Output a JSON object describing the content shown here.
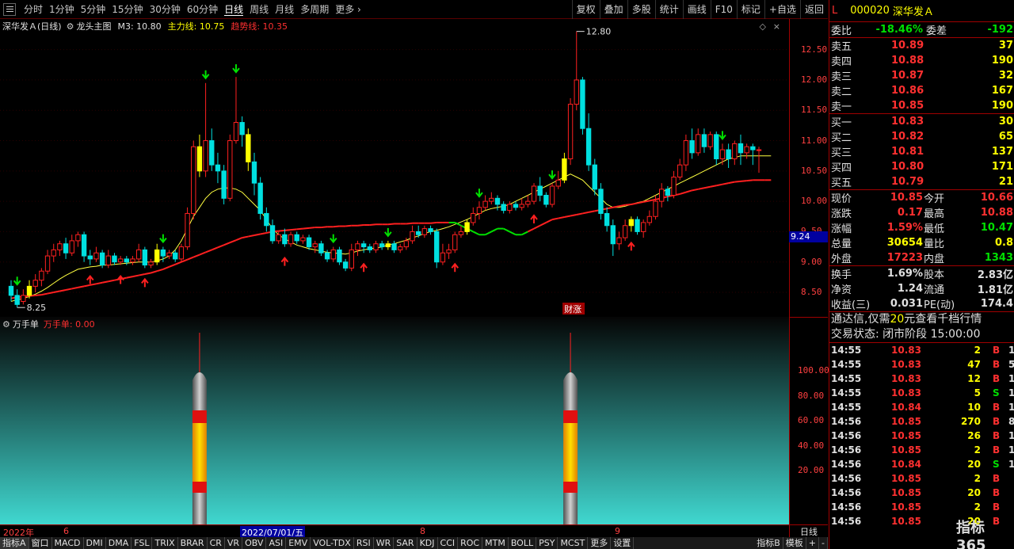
{
  "toolbar": {
    "periods": [
      "分时",
      "1分钟",
      "5分钟",
      "15分钟",
      "30分钟",
      "60分钟",
      "日线",
      "周线",
      "月线",
      "多周期",
      "更多"
    ],
    "active_period": "日线",
    "tools": [
      "复权",
      "叠加",
      "多股",
      "统计",
      "画线",
      "F10",
      "标记",
      "+自选",
      "返回"
    ]
  },
  "main_header": {
    "stock": "深华发Ａ(日线)",
    "indicator": "龙头主图",
    "m3": "M3: 10.80",
    "main_line": "主力线: 10.75",
    "trend_line": "趋势线: 10.35"
  },
  "main_y_ticks": [
    "12.50",
    "12.00",
    "11.50",
    "11.00",
    "10.50",
    "10.00",
    "9.50",
    "9.00",
    "8.50"
  ],
  "price_tag": "9.24",
  "annotations": {
    "high": "12.80",
    "low": "8.25",
    "event": "财涨"
  },
  "sub_header": {
    "name": "万手单",
    "value": "万手单: 0.00"
  },
  "sub_y_ticks": [
    "100.00",
    "80.00",
    "60.00",
    "40.00",
    "20.00"
  ],
  "time_axis": {
    "labels": [
      "2022年",
      "6",
      "8",
      "9"
    ],
    "cursor_date": "2022/07/01/五",
    "period_button": "日线"
  },
  "indicator_tabs": [
    "指标A",
    "窗口",
    "MACD",
    "DMI",
    "DMA",
    "FSL",
    "TRIX",
    "BRAR",
    "CR",
    "VR",
    "OBV",
    "ASI",
    "EMV",
    "VOL-TDX",
    "RSI",
    "WR",
    "SAR",
    "KDJ",
    "CCI",
    "ROC",
    "MTM",
    "BOLL",
    "PSY",
    "MCST",
    "更多",
    "设置"
  ],
  "indicator_tabs_right": [
    "指标B",
    "模板",
    "+",
    "-"
  ],
  "quote": {
    "market": "L",
    "code": "000020",
    "name": "深华发Ａ",
    "weibi_label": "委比",
    "weibi": "-18.46%",
    "weicha_label": "委差",
    "weicha": "-192",
    "sells": [
      {
        "label": "卖五",
        "price": "10.89",
        "vol": "37"
      },
      {
        "label": "卖四",
        "price": "10.88",
        "vol": "190"
      },
      {
        "label": "卖三",
        "price": "10.87",
        "vol": "32"
      },
      {
        "label": "卖二",
        "price": "10.86",
        "vol": "167"
      },
      {
        "label": "卖一",
        "price": "10.85",
        "vol": "190"
      }
    ],
    "buys": [
      {
        "label": "买一",
        "price": "10.83",
        "vol": "30"
      },
      {
        "label": "买二",
        "price": "10.82",
        "vol": "65"
      },
      {
        "label": "买三",
        "price": "10.81",
        "vol": "137"
      },
      {
        "label": "买四",
        "price": "10.80",
        "vol": "171"
      },
      {
        "label": "买五",
        "price": "10.79",
        "vol": "21"
      }
    ],
    "stats1": [
      {
        "l1": "现价",
        "v1": "10.85",
        "c1": "red",
        "l2": "今开",
        "v2": "10.66",
        "c2": "red"
      },
      {
        "l1": "涨跌",
        "v1": "0.17",
        "c1": "red",
        "l2": "最高",
        "v2": "10.88",
        "c2": "red"
      },
      {
        "l1": "涨幅",
        "v1": "1.59%",
        "c1": "red",
        "l2": "最低",
        "v2": "10.47",
        "c2": "grn"
      },
      {
        "l1": "总量",
        "v1": "30654",
        "c1": "yel",
        "l2": "量比",
        "v2": "0.8",
        "c2": "yel"
      },
      {
        "l1": "外盘",
        "v1": "17223",
        "c1": "red",
        "l2": "内盘",
        "v2": "1343",
        "c2": "grn"
      }
    ],
    "stats2": [
      {
        "l1": "换手",
        "v1": "1.69%",
        "c1": "wht",
        "l2": "股本",
        "v2": "2.83亿",
        "c2": "wht"
      },
      {
        "l1": "净资",
        "v1": "1.24",
        "c1": "wht",
        "l2": "流通",
        "v2": "1.81亿",
        "c2": "wht"
      },
      {
        "l1": "收益(三)",
        "v1": "0.031",
        "c1": "wht",
        "l2": "PE(动)",
        "v2": "174.4",
        "c2": "wht"
      }
    ],
    "banner_prefix": "通达信,仅需",
    "banner_price": "20",
    "banner_suffix": "元查看千档行情",
    "status": "交易状态: 闭市阶段 15:00:00"
  },
  "ticks": [
    {
      "t": "14:55",
      "p": "10.83",
      "v": "2",
      "s": "B",
      "n": "1"
    },
    {
      "t": "14:55",
      "p": "10.83",
      "v": "47",
      "s": "B",
      "n": "5"
    },
    {
      "t": "14:55",
      "p": "10.83",
      "v": "12",
      "s": "B",
      "n": "1"
    },
    {
      "t": "14:55",
      "p": "10.83",
      "v": "5",
      "s": "S",
      "n": "1"
    },
    {
      "t": "14:55",
      "p": "10.84",
      "v": "10",
      "s": "B",
      "n": "1"
    },
    {
      "t": "14:56",
      "p": "10.85",
      "v": "270",
      "s": "B",
      "n": "8"
    },
    {
      "t": "14:56",
      "p": "10.85",
      "v": "26",
      "s": "B",
      "n": "1"
    },
    {
      "t": "14:56",
      "p": "10.85",
      "v": "2",
      "s": "B",
      "n": "1"
    },
    {
      "t": "14:56",
      "p": "10.84",
      "v": "20",
      "s": "S",
      "n": "1"
    },
    {
      "t": "14:56",
      "p": "10.85",
      "v": "2",
      "s": "B",
      "n": ""
    },
    {
      "t": "14:56",
      "p": "10.85",
      "v": "20",
      "s": "B",
      "n": ""
    },
    {
      "t": "14:56",
      "p": "10.85",
      "v": "2",
      "s": "B",
      "n": ""
    },
    {
      "t": "14:56",
      "p": "10.85",
      "v": "20",
      "s": "B",
      "n": ""
    }
  ],
  "logo": "指标365",
  "chart_data": {
    "type": "candlestick",
    "ylim": [
      8.2,
      12.9
    ],
    "candles": [
      [
        8.6,
        8.45,
        8.7,
        8.35
      ],
      [
        8.45,
        8.3,
        8.55,
        8.25
      ],
      [
        8.35,
        8.45,
        8.55,
        8.3
      ],
      [
        8.45,
        8.6,
        8.7,
        8.4
      ],
      [
        8.6,
        8.7,
        8.8,
        8.5
      ],
      [
        8.7,
        8.85,
        8.9,
        8.6
      ],
      [
        8.85,
        9.1,
        9.2,
        8.8
      ],
      [
        9.1,
        9.2,
        9.3,
        9.0
      ],
      [
        9.2,
        9.3,
        9.35,
        9.1
      ],
      [
        9.3,
        9.15,
        9.4,
        9.05
      ],
      [
        9.15,
        9.35,
        9.45,
        9.1
      ],
      [
        9.35,
        9.45,
        9.5,
        9.25
      ],
      [
        9.45,
        9.1,
        9.5,
        9.0
      ],
      [
        9.1,
        9.05,
        9.2,
        8.95
      ],
      [
        9.05,
        9.15,
        9.25,
        9.0
      ],
      [
        9.15,
        8.95,
        9.2,
        8.9
      ],
      [
        8.95,
        9.1,
        9.2,
        8.9
      ],
      [
        9.1,
        9.0,
        9.15,
        8.95
      ],
      [
        9.0,
        9.05,
        9.1,
        8.95
      ],
      [
        9.05,
        9.0,
        9.1,
        8.95
      ],
      [
        9.0,
        9.05,
        9.1,
        8.95
      ],
      [
        9.05,
        9.2,
        9.3,
        9.0
      ],
      [
        9.2,
        8.95,
        9.25,
        8.9
      ],
      [
        8.95,
        9.0,
        9.05,
        8.9
      ],
      [
        9.0,
        9.2,
        9.3,
        8.95
      ],
      [
        9.2,
        9.1,
        9.25,
        9.0
      ],
      [
        9.1,
        9.15,
        9.2,
        9.05
      ],
      [
        9.15,
        9.05,
        9.2,
        9.0
      ],
      [
        9.05,
        9.25,
        9.3,
        9.0
      ],
      [
        9.25,
        9.8,
        9.9,
        9.2
      ],
      [
        9.8,
        10.9,
        11.0,
        9.7
      ],
      [
        10.9,
        10.5,
        11.1,
        10.4
      ],
      [
        10.5,
        11.0,
        11.95,
        10.4
      ],
      [
        11.0,
        10.6,
        11.2,
        10.5
      ],
      [
        10.6,
        10.5,
        10.8,
        10.3
      ],
      [
        10.5,
        10.05,
        10.6,
        9.95
      ],
      [
        10.05,
        11.0,
        11.1,
        10.0
      ],
      [
        11.0,
        11.3,
        12.05,
        10.95
      ],
      [
        11.3,
        11.1,
        11.4,
        10.9
      ],
      [
        11.1,
        10.65,
        11.2,
        10.5
      ],
      [
        10.65,
        10.3,
        10.8,
        10.1
      ],
      [
        10.3,
        9.8,
        10.4,
        9.7
      ],
      [
        9.8,
        9.6,
        9.9,
        9.5
      ],
      [
        9.6,
        9.35,
        9.7,
        9.3
      ],
      [
        9.35,
        9.45,
        9.5,
        9.3
      ],
      [
        9.45,
        9.3,
        9.55,
        9.25
      ],
      [
        9.3,
        9.45,
        9.5,
        9.25
      ],
      [
        9.45,
        9.35,
        9.5,
        9.3
      ],
      [
        9.35,
        9.4,
        9.45,
        9.3
      ],
      [
        9.4,
        9.25,
        9.45,
        9.2
      ],
      [
        9.25,
        9.3,
        9.35,
        9.15
      ],
      [
        9.3,
        9.15,
        9.35,
        9.1
      ],
      [
        9.15,
        9.05,
        9.2,
        9.0
      ],
      [
        9.05,
        9.2,
        9.25,
        9.0
      ],
      [
        9.2,
        9.0,
        9.25,
        8.95
      ],
      [
        9.0,
        8.9,
        9.05,
        8.85
      ],
      [
        8.9,
        9.2,
        9.3,
        8.85
      ],
      [
        9.2,
        9.3,
        9.35,
        9.1
      ],
      [
        9.3,
        9.25,
        9.35,
        9.15
      ],
      [
        9.25,
        9.2,
        9.3,
        9.15
      ],
      [
        9.2,
        9.3,
        9.35,
        9.15
      ],
      [
        9.3,
        9.25,
        9.35,
        9.2
      ],
      [
        9.25,
        9.3,
        9.35,
        9.2
      ],
      [
        9.3,
        9.2,
        9.35,
        9.15
      ],
      [
        9.2,
        9.25,
        9.3,
        9.15
      ],
      [
        9.25,
        9.35,
        9.4,
        9.2
      ],
      [
        9.35,
        9.5,
        9.6,
        9.3
      ],
      [
        9.5,
        9.45,
        9.6,
        9.4
      ],
      [
        9.45,
        9.55,
        9.6,
        9.4
      ],
      [
        9.55,
        9.5,
        9.6,
        9.45
      ],
      [
        9.5,
        9.0,
        9.55,
        8.9
      ],
      [
        9.0,
        9.15,
        9.3,
        8.95
      ],
      [
        9.15,
        9.2,
        9.3,
        9.05
      ],
      [
        9.2,
        9.45,
        9.5,
        9.15
      ],
      [
        9.45,
        9.5,
        9.6,
        9.4
      ],
      [
        9.5,
        9.65,
        9.7,
        9.45
      ],
      [
        9.65,
        9.8,
        9.9,
        9.6
      ],
      [
        9.8,
        9.9,
        10.0,
        9.7
      ],
      [
        9.9,
        10.0,
        10.1,
        9.85
      ],
      [
        10.0,
        10.05,
        10.15,
        9.95
      ],
      [
        10.05,
        9.95,
        10.1,
        9.85
      ],
      [
        9.95,
        9.85,
        10.0,
        9.8
      ],
      [
        9.85,
        9.95,
        10.0,
        9.8
      ],
      [
        9.95,
        9.9,
        10.0,
        9.85
      ],
      [
        9.9,
        9.95,
        10.05,
        9.85
      ],
      [
        9.95,
        10.0,
        10.1,
        9.9
      ],
      [
        10.0,
        10.25,
        10.3,
        9.95
      ],
      [
        10.25,
        10.1,
        10.4,
        10.0
      ],
      [
        10.1,
        9.95,
        10.15,
        9.9
      ],
      [
        9.95,
        10.25,
        10.3,
        9.9
      ],
      [
        10.25,
        10.35,
        10.5,
        10.2
      ],
      [
        10.35,
        10.7,
        10.8,
        10.3
      ],
      [
        10.7,
        11.6,
        11.7,
        10.6
      ],
      [
        11.6,
        12.0,
        12.8,
        11.5
      ],
      [
        12.0,
        11.2,
        12.05,
        11.1
      ],
      [
        11.2,
        10.6,
        11.45,
        10.5
      ],
      [
        10.6,
        10.2,
        10.7,
        10.1
      ],
      [
        10.2,
        9.8,
        10.3,
        9.7
      ],
      [
        9.8,
        9.6,
        9.9,
        9.5
      ],
      [
        9.6,
        9.3,
        9.7,
        9.1
      ],
      [
        9.3,
        9.4,
        9.5,
        9.2
      ],
      [
        9.4,
        9.6,
        9.7,
        9.35
      ],
      [
        9.6,
        9.7,
        9.75,
        9.5
      ],
      [
        9.7,
        9.5,
        9.75,
        9.45
      ],
      [
        9.5,
        9.65,
        9.7,
        9.4
      ],
      [
        9.65,
        9.75,
        9.85,
        9.6
      ],
      [
        9.75,
        10.0,
        10.1,
        9.7
      ],
      [
        10.0,
        10.2,
        10.3,
        9.9
      ],
      [
        10.2,
        10.1,
        10.25,
        10.0
      ],
      [
        10.1,
        10.4,
        10.5,
        10.05
      ],
      [
        10.4,
        10.6,
        10.7,
        10.35
      ],
      [
        10.6,
        11.0,
        11.1,
        10.5
      ],
      [
        11.0,
        10.8,
        11.2,
        10.7
      ],
      [
        10.8,
        11.1,
        11.2,
        10.75
      ],
      [
        11.1,
        10.9,
        11.2,
        10.8
      ],
      [
        10.9,
        11.1,
        11.15,
        10.85
      ],
      [
        11.1,
        10.7,
        11.15,
        10.6
      ],
      [
        10.7,
        10.85,
        10.95,
        10.6
      ],
      [
        10.85,
        10.7,
        10.95,
        10.55
      ],
      [
        10.7,
        10.95,
        11.0,
        10.6
      ],
      [
        10.95,
        10.8,
        11.1,
        10.6
      ],
      [
        10.8,
        10.9,
        10.95,
        10.7
      ],
      [
        10.9,
        10.85,
        10.95,
        10.6
      ],
      [
        10.85,
        10.85,
        10.9,
        10.47
      ]
    ],
    "highlight_indices": [
      3,
      24,
      31,
      39,
      62,
      75,
      91,
      102
    ],
    "line_main": [
      8.35,
      8.38,
      8.4,
      8.43,
      8.47,
      8.52,
      8.58,
      8.65,
      8.72,
      8.78,
      8.83,
      8.88,
      8.9,
      8.92,
      8.93,
      8.95,
      8.95,
      8.96,
      8.97,
      8.98,
      8.99,
      9.0,
      9.0,
      9.0,
      9.02,
      9.05,
      9.1,
      9.2,
      9.35,
      9.55,
      9.75,
      9.9,
      10.05,
      10.15,
      10.2,
      10.22,
      10.22,
      10.2,
      10.15,
      10.05,
      9.95,
      9.85,
      9.7,
      9.55,
      9.45,
      9.38,
      9.33,
      9.28,
      9.25,
      9.22,
      9.2,
      9.18,
      9.16,
      9.15,
      9.14,
      9.13,
      9.15,
      9.18,
      9.2,
      9.22,
      9.23,
      9.25,
      9.28,
      9.3,
      9.33,
      9.36,
      9.4,
      9.43,
      9.47,
      9.5,
      9.52,
      9.55,
      9.58,
      9.62,
      9.66,
      9.7,
      9.75,
      9.8,
      9.85,
      9.88,
      9.9,
      9.92,
      9.95,
      10.0,
      10.05,
      10.1,
      10.15,
      10.2,
      10.25,
      10.3,
      10.35,
      10.4,
      10.45,
      10.4,
      10.35,
      10.25,
      10.15,
      10.05,
      9.95,
      9.9,
      9.9,
      9.92,
      9.95,
      9.98,
      10.0,
      10.05,
      10.1,
      10.15,
      10.2,
      10.25,
      10.3,
      10.35,
      10.4,
      10.45,
      10.5,
      10.55,
      10.6,
      10.65,
      10.7,
      10.72,
      10.75,
      10.75,
      10.75,
      10.75,
      10.75,
      10.75
    ],
    "line_trend": [
      8.4,
      8.42,
      8.43,
      8.44,
      8.45,
      8.46,
      8.48,
      8.5,
      8.52,
      8.54,
      8.56,
      8.58,
      8.6,
      8.62,
      8.64,
      8.66,
      8.68,
      8.7,
      8.72,
      8.74,
      8.76,
      8.78,
      8.8,
      8.82,
      8.85,
      8.88,
      8.92,
      8.96,
      9.0,
      9.04,
      9.08,
      9.12,
      9.16,
      9.2,
      9.24,
      9.28,
      9.32,
      9.36,
      9.4,
      9.42,
      9.44,
      9.46,
      9.48,
      9.5,
      9.51,
      9.52,
      9.53,
      9.54,
      9.55,
      9.56,
      9.57,
      9.57,
      9.58,
      9.58,
      9.59,
      9.59,
      9.6,
      9.6,
      9.61,
      9.61,
      9.62,
      9.62,
      9.62,
      9.63,
      9.63,
      9.63,
      9.64,
      9.64,
      9.64,
      9.64,
      9.65,
      9.65,
      9.65,
      9.65,
      9.6,
      9.55,
      9.5,
      9.45,
      9.45,
      9.5,
      9.55,
      9.55,
      9.5,
      9.45,
      9.45,
      9.5,
      9.55,
      9.6,
      9.65,
      9.7,
      9.72,
      9.74,
      9.76,
      9.78,
      9.8,
      9.82,
      9.84,
      9.86,
      9.88,
      9.9,
      9.92,
      9.94,
      9.95,
      9.97,
      9.99,
      10.01,
      10.03,
      10.05,
      10.08,
      10.1,
      10.12,
      10.15,
      10.18,
      10.2,
      10.22,
      10.24,
      10.26,
      10.28,
      10.3,
      10.32,
      10.33,
      10.34,
      10.35,
      10.35,
      10.35,
      10.35
    ]
  }
}
